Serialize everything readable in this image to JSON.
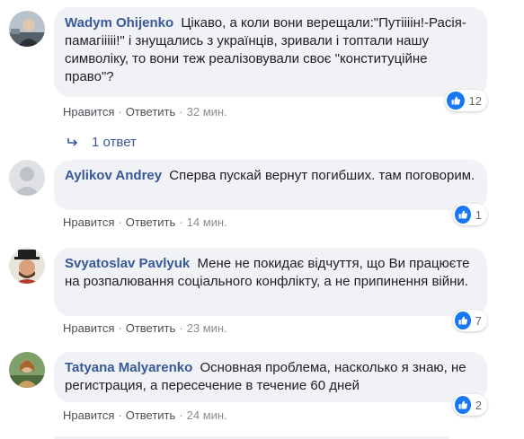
{
  "comments": [
    {
      "author": "Wadym Ohijenko",
      "text": "Цікаво, а коли вони верещали:\"Путіііін!-Расія-памагііііі!\" і знущались з українців, зривали і топтали нашу символіку, то вони теж реалізовували своє \"конституційне право\"?",
      "like_label": "Нравится",
      "reply_label": "Ответить",
      "time": "32 мин.",
      "reaction_count": "12",
      "avatar": "avatar-person-photo"
    },
    {
      "author": "Aylikov Andrey",
      "text": "Сперва пускай вернут погибших. там поговорим.",
      "like_label": "Нравится",
      "reply_label": "Ответить",
      "time": "14 мин.",
      "reaction_count": "1",
      "avatar": "default-avatar-silhouette"
    },
    {
      "author": "Svyatoslav Pavlyuk",
      "text": "Мене не покидає відчуття, що Ви працюєте на розпалювання соціального конфлікту, а не припинення війни.",
      "like_label": "Нравится",
      "reply_label": "Ответить",
      "time": "23 мин.",
      "reaction_count": "7",
      "avatar": "avatar-man-hat"
    },
    {
      "author": "Tatyana Malyarenko",
      "text": "Основная проблема, насколько я знаю, не регистрация, а пересечение в течение 60 дней",
      "like_label": "Нравится",
      "reply_label": "Ответить",
      "time": "24 мин.",
      "reaction_count": "2",
      "avatar": "avatar-woman-outdoor"
    }
  ],
  "replies_link": "1 ответ",
  "colors": {
    "author": "#385898",
    "bubble": "#f0f2f5",
    "like_blue": "#1877f2",
    "meta": "#65676b"
  }
}
